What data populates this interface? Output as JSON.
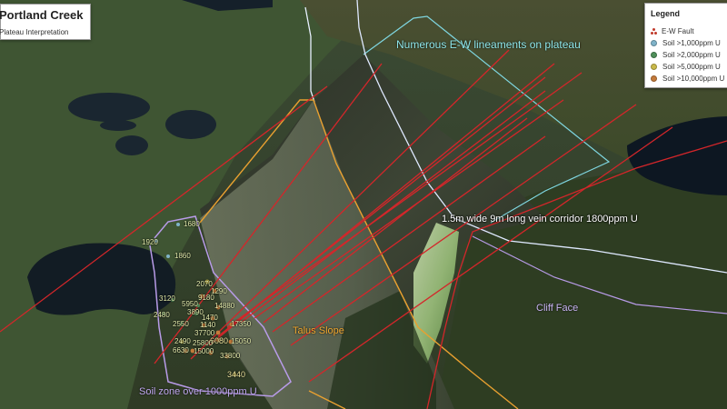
{
  "title": {
    "name": "Portland Creek",
    "subtitle": "Plateau Interpretation"
  },
  "legend": {
    "heading": "Legend",
    "items": [
      {
        "label": "E-W Fault",
        "color": "#c0392b"
      },
      {
        "label": "Soil >1,000ppm U",
        "color": "#7fb3c9"
      },
      {
        "label": "Soil >2,000ppm U",
        "color": "#4f8f5a"
      },
      {
        "label": "Soil >5,000ppm U",
        "color": "#c9b94a"
      },
      {
        "label": "Soil >10,000ppm U",
        "color": "#c47a3a"
      }
    ]
  },
  "annotations": {
    "lineaments": "Numerous E-W lineaments on plateau",
    "vein": "1.5m wide 9m long vein corridor 1800ppm U",
    "cliff": "Cliff Face",
    "talus": "Talus Slope",
    "soil_zone": "Soil zone over 1000ppm U"
  },
  "soil_values": [
    "1680",
    "1920",
    "1860",
    "2070",
    "1290",
    "9180",
    "3120",
    "5950",
    "2480",
    "3890",
    "14880",
    "1470",
    "2550",
    "1140",
    "37700",
    "17350",
    "2490",
    "6080",
    "25800",
    "15050",
    "6630",
    "15000",
    "33800",
    "3440"
  ],
  "colors": {
    "fault": "#d4262a",
    "soil_boundary": "#b89be8",
    "plateau_outline": "#7fd6e0",
    "talus_outline": "#e8a030",
    "white_line": "#e8f0ff"
  }
}
